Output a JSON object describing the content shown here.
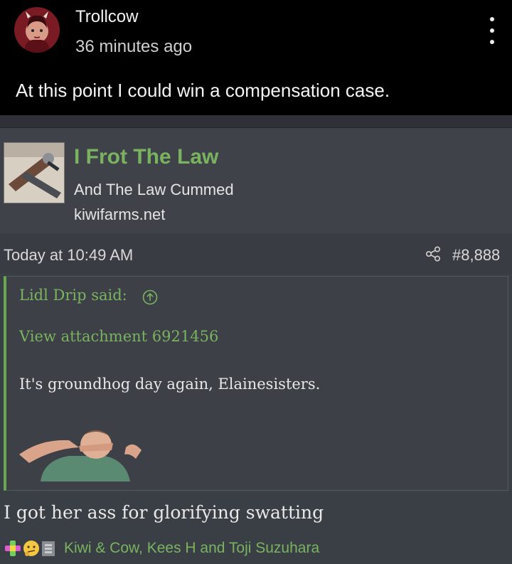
{
  "comment": {
    "username": "Trollcow",
    "time_ago": "36 minutes ago",
    "text": "At this point I could win a compensation case.",
    "avatar_icon": "profile-avatar-icon",
    "menu_icon": "more-vertical-icon"
  },
  "embed": {
    "link_title": "I Frot The Law",
    "link_description": "And The Law Cummed",
    "link_domain": "kiwifarms.net",
    "thumbnail_icon": "link-thumbnail-image",
    "post_date": "Today at 10:49 AM",
    "share_icon": "share-icon",
    "post_number": "#8,888",
    "quote": {
      "author_line": "Lidl Drip said:",
      "jump_icon": "arrow-up-circle-icon",
      "attachment_link": "View attachment 6921456",
      "text": "It's groundhog day again, Elainesisters.",
      "image_icon": "quoted-image"
    },
    "body": "I got her ass for glorifying swatting",
    "reaction_icons": [
      "plus-reaction-icon",
      "thinking-emoji-icon",
      "like-reaction-icon"
    ],
    "reaction_users": "Kiwi & Cow, Kees H and Toji Suzuhara"
  },
  "colors": {
    "accent_green": "#7ab35f",
    "card_background": "#3a3f45",
    "comment_background": "#000000"
  }
}
